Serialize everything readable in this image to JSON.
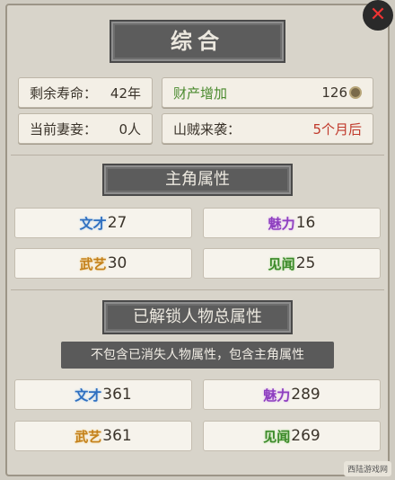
{
  "title": "综合",
  "info": {
    "lifespan_label": "剩余寿命：",
    "lifespan_value": "42年",
    "wealth_label": "财产增加",
    "wealth_value": "126",
    "spouses_label": "当前妻妾：",
    "spouses_value": "0人",
    "bandit_label": "山贼来袭：",
    "bandit_value": "5个月后"
  },
  "hero_section": {
    "title": "主角属性",
    "stats": [
      {
        "badge": "文才",
        "value": "27",
        "color": "#2f6fbf"
      },
      {
        "badge": "魅力",
        "value": "16",
        "color": "#8e3fbf"
      },
      {
        "badge": "武艺",
        "value": "30",
        "color": "#c4801a"
      },
      {
        "badge": "见闻",
        "value": "25",
        "color": "#3c8a2a"
      }
    ]
  },
  "total_section": {
    "title": "已解锁人物总属性",
    "notice": "不包含已消失人物属性，包含主角属性",
    "stats": [
      {
        "badge": "文才",
        "value": "361"
      },
      {
        "badge": "魅力",
        "value": "289"
      },
      {
        "badge": "武艺",
        "value": "361"
      },
      {
        "badge": "见闻",
        "value": "269"
      }
    ]
  },
  "watermark": "西陆游戏网",
  "icons": {
    "close": "close-icon",
    "coin": "coin-icon"
  }
}
